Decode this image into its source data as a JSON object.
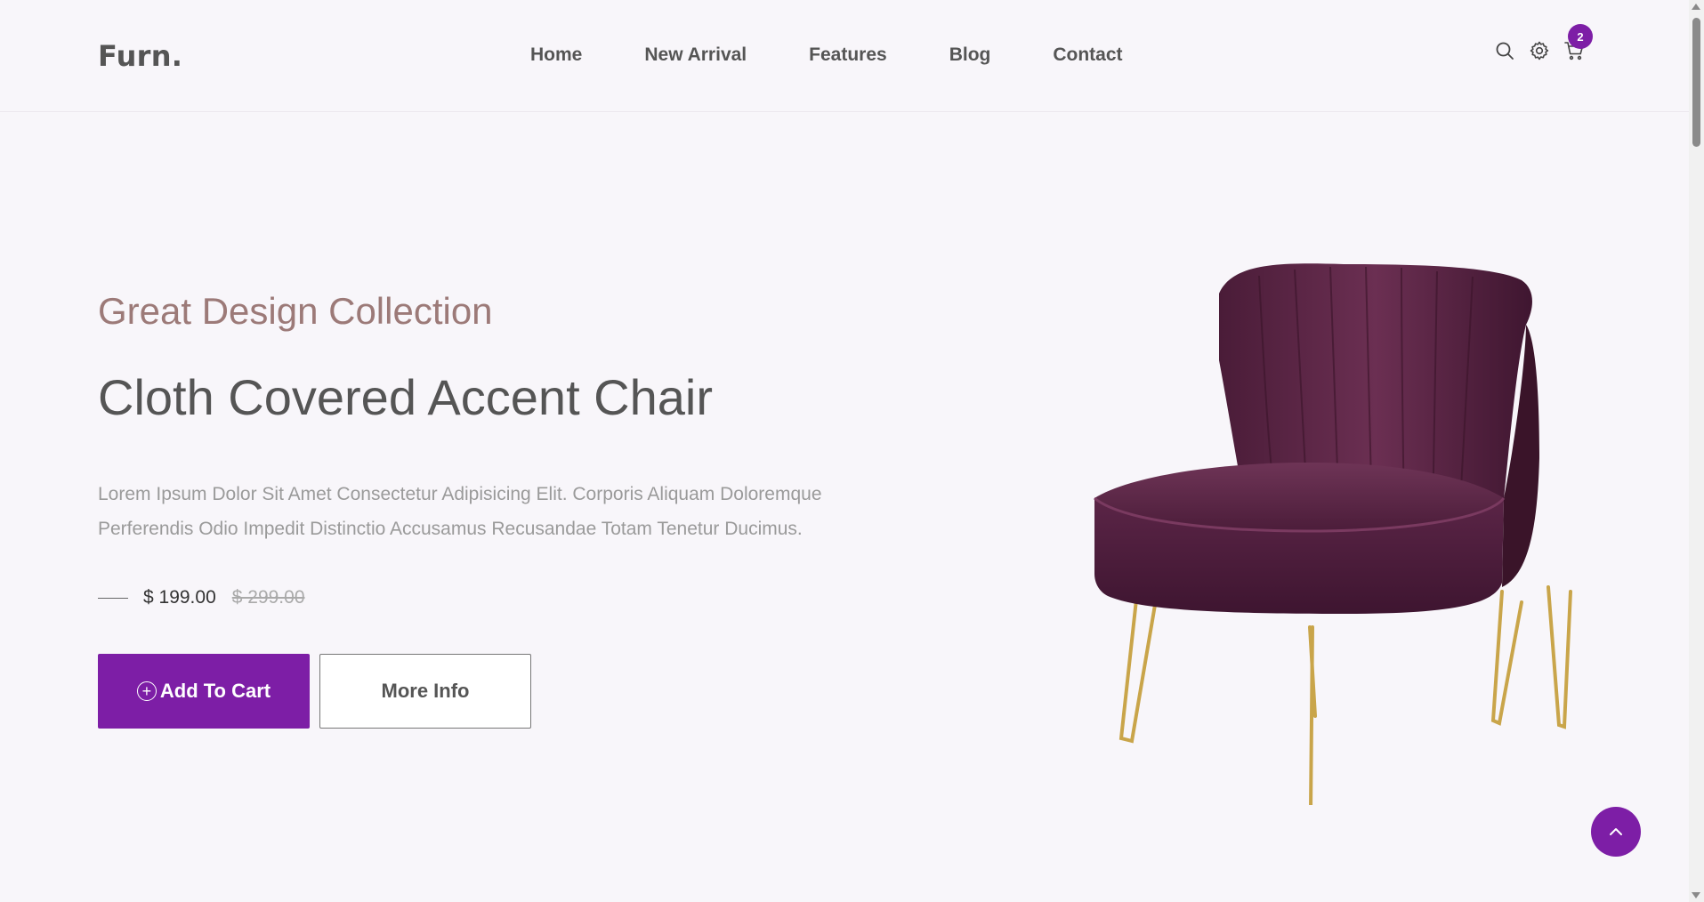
{
  "header": {
    "logo": "Furn.",
    "nav": [
      {
        "label": "Home"
      },
      {
        "label": "New Arrival"
      },
      {
        "label": "Features"
      },
      {
        "label": "Blog"
      },
      {
        "label": "Contact"
      }
    ],
    "icons": {
      "search": "search-icon",
      "settings": "gear-icon",
      "cart": "cart-icon"
    },
    "cart_count": "2"
  },
  "hero": {
    "subtitle": "Great Design Collection",
    "title": "Cloth Covered Accent Chair",
    "description": "Lorem Ipsum Dolor Sit Amet Consectetur Adipisicing Elit. Corporis Aliquam Doloremque Perferendis Odio Impedit Distinctio Accusamus Recusandae Totam Tenetur Ducimus.",
    "price_current": "$ 199.00",
    "price_old": "$ 299.00",
    "add_to_cart_label": "Add To Cart",
    "more_info_label": "More Info"
  },
  "colors": {
    "accent": "#7d1ea6",
    "subtitle": "#9c7a78",
    "chair": "#5e2846",
    "legs": "#c9a54a"
  }
}
